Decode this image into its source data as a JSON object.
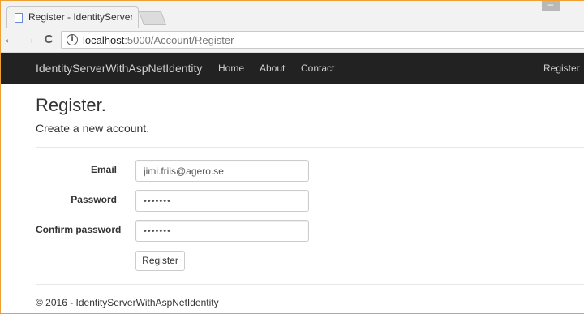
{
  "browser": {
    "tab_title": "Register - IdentityServerW",
    "back_glyph": "←",
    "forward_glyph": "→",
    "reload_glyph": "C",
    "info_glyph": "i",
    "url_host": "localhost",
    "url_path": ":5000/Account/Register",
    "window_control_glyph": "–"
  },
  "navbar": {
    "brand": "IdentityServerWithAspNetIdentity",
    "links": [
      "Home",
      "About",
      "Contact"
    ],
    "right_link": "Register",
    "background": "#222222"
  },
  "page": {
    "title": "Register.",
    "subtitle": "Create a new account."
  },
  "form": {
    "email_label": "Email",
    "email_value": "jimi.friis@agero.se",
    "password_label": "Password",
    "password_value": "•••••••",
    "confirm_label": "Confirm password",
    "confirm_value": "•••••••",
    "submit_label": "Register"
  },
  "footer": {
    "text": "© 2016 - IdentityServerWithAspNetIdentity"
  }
}
